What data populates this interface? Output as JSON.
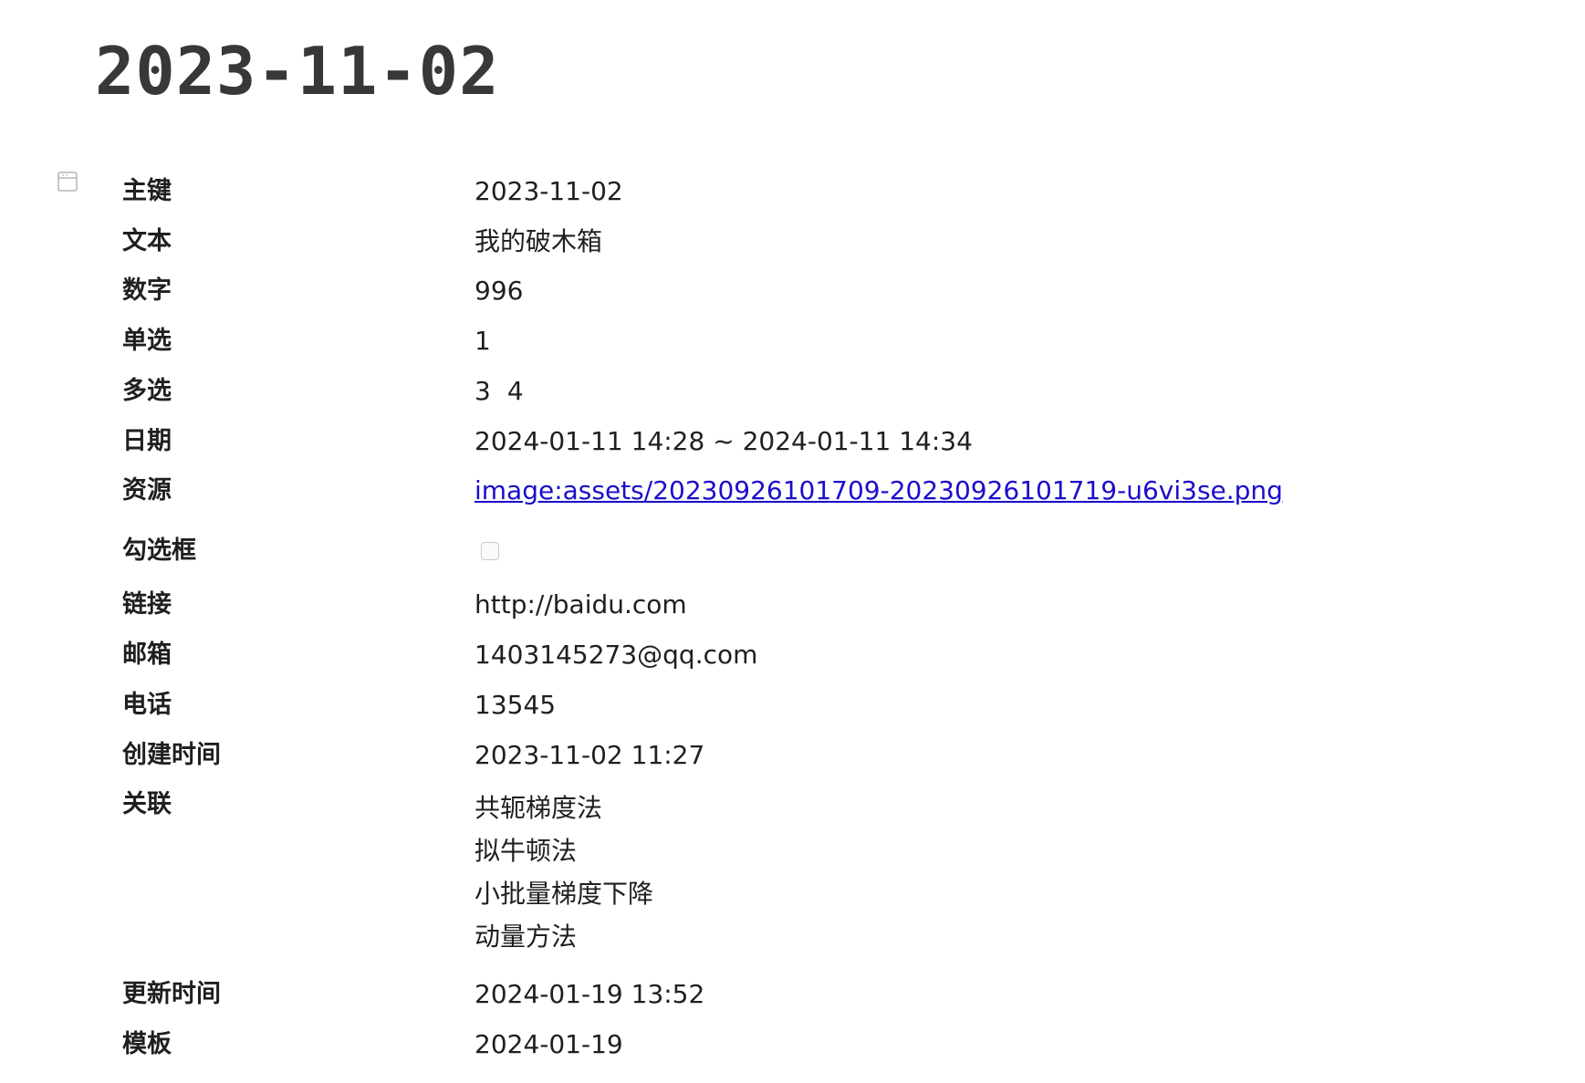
{
  "title": "2023-11-02",
  "icons": {
    "block": "table-view-icon"
  },
  "properties": {
    "primary_key": {
      "label": "主键",
      "value": "2023-11-02"
    },
    "text": {
      "label": "文本",
      "value": "我的破木箱"
    },
    "number": {
      "label": "数字",
      "value": "996"
    },
    "single_select": {
      "label": "单选",
      "value": "1"
    },
    "multi_select": {
      "label": "多选",
      "values": [
        "3",
        "4"
      ]
    },
    "date": {
      "label": "日期",
      "value": "2024-01-11 14:28 ~ 2024-01-11 14:34"
    },
    "asset": {
      "label": "资源",
      "value": "image:assets/20230926101709-20230926101719-u6vi3se.png"
    },
    "checkbox": {
      "label": "勾选框",
      "checked": false
    },
    "url": {
      "label": "链接",
      "value": "http://baidu.com"
    },
    "email": {
      "label": "邮箱",
      "value": "1403145273@qq.com"
    },
    "phone": {
      "label": "电话",
      "value": "13545"
    },
    "created": {
      "label": "创建时间",
      "value": "2023-11-02 11:27"
    },
    "relation": {
      "label": "关联",
      "values": [
        "共轭梯度法",
        "拟牛顿法",
        "小批量梯度下降",
        "动量方法"
      ]
    },
    "updated": {
      "label": "更新时间",
      "value": "2024-01-19 13:52"
    },
    "template": {
      "label": "模板",
      "value": "2024-01-19"
    }
  },
  "colors": {
    "title": "#383838",
    "text": "#1f1f1f",
    "link": "#1a0dcc",
    "icon": "#b5b5b5"
  }
}
